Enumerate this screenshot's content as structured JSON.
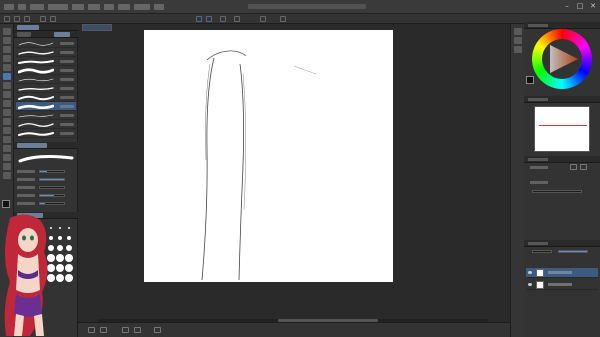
{
  "window": {
    "minimize_glyph": "–",
    "maximize_glyph": "□",
    "close_glyph": "✕"
  },
  "tools": [
    {
      "icon": "zoom-icon"
    },
    {
      "icon": "move-icon"
    },
    {
      "icon": "select-icon"
    },
    {
      "icon": "lasso-icon"
    },
    {
      "icon": "eyedropper-icon"
    },
    {
      "icon": "pen-icon",
      "active": true
    },
    {
      "icon": "pencil-icon"
    },
    {
      "icon": "brush-icon"
    },
    {
      "icon": "airbrush-icon"
    },
    {
      "icon": "blend-icon"
    },
    {
      "icon": "eraser-icon"
    },
    {
      "icon": "fill-icon"
    },
    {
      "icon": "gradient-icon"
    },
    {
      "icon": "figure-icon"
    },
    {
      "icon": "text-icon"
    },
    {
      "icon": "balloon-icon"
    },
    {
      "icon": "ruler-icon"
    }
  ],
  "brushes": [
    {
      "selected": false
    },
    {
      "selected": false
    },
    {
      "selected": false
    },
    {
      "selected": false
    },
    {
      "selected": false
    },
    {
      "selected": false
    },
    {
      "selected": false
    },
    {
      "selected": true
    },
    {
      "selected": false
    },
    {
      "selected": false
    },
    {
      "selected": false
    }
  ],
  "brush_properties": [
    {
      "level": 0.3
    },
    {
      "level": 1.0
    },
    {
      "level": 0.0
    },
    {
      "level": 0.6
    },
    {
      "level": 0.2
    }
  ],
  "colors": {
    "accent": "#4a78b0",
    "selection": "#3d5a80",
    "main_color": "#111111",
    "sub_color": "#ffffff",
    "canvas_bg": "#2a2a2a",
    "paper": "#ffffff"
  }
}
